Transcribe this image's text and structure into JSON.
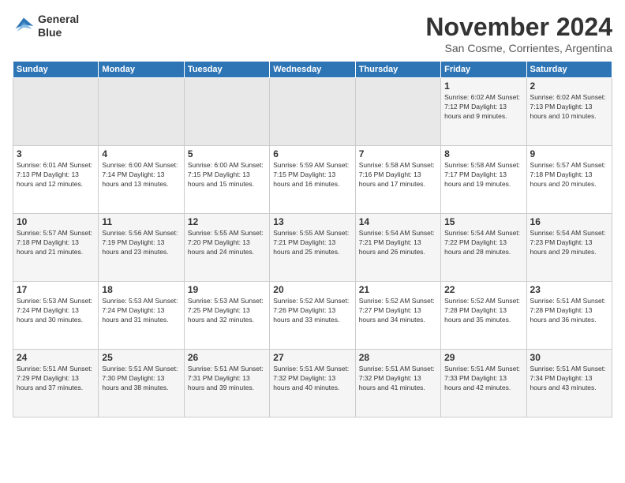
{
  "header": {
    "logo_line1": "General",
    "logo_line2": "Blue",
    "month": "November 2024",
    "location": "San Cosme, Corrientes, Argentina"
  },
  "weekdays": [
    "Sunday",
    "Monday",
    "Tuesday",
    "Wednesday",
    "Thursday",
    "Friday",
    "Saturday"
  ],
  "weeks": [
    [
      {
        "day": "",
        "info": ""
      },
      {
        "day": "",
        "info": ""
      },
      {
        "day": "",
        "info": ""
      },
      {
        "day": "",
        "info": ""
      },
      {
        "day": "",
        "info": ""
      },
      {
        "day": "1",
        "info": "Sunrise: 6:02 AM\nSunset: 7:12 PM\nDaylight: 13 hours\nand 9 minutes."
      },
      {
        "day": "2",
        "info": "Sunrise: 6:02 AM\nSunset: 7:13 PM\nDaylight: 13 hours\nand 10 minutes."
      }
    ],
    [
      {
        "day": "3",
        "info": "Sunrise: 6:01 AM\nSunset: 7:13 PM\nDaylight: 13 hours\nand 12 minutes."
      },
      {
        "day": "4",
        "info": "Sunrise: 6:00 AM\nSunset: 7:14 PM\nDaylight: 13 hours\nand 13 minutes."
      },
      {
        "day": "5",
        "info": "Sunrise: 6:00 AM\nSunset: 7:15 PM\nDaylight: 13 hours\nand 15 minutes."
      },
      {
        "day": "6",
        "info": "Sunrise: 5:59 AM\nSunset: 7:15 PM\nDaylight: 13 hours\nand 16 minutes."
      },
      {
        "day": "7",
        "info": "Sunrise: 5:58 AM\nSunset: 7:16 PM\nDaylight: 13 hours\nand 17 minutes."
      },
      {
        "day": "8",
        "info": "Sunrise: 5:58 AM\nSunset: 7:17 PM\nDaylight: 13 hours\nand 19 minutes."
      },
      {
        "day": "9",
        "info": "Sunrise: 5:57 AM\nSunset: 7:18 PM\nDaylight: 13 hours\nand 20 minutes."
      }
    ],
    [
      {
        "day": "10",
        "info": "Sunrise: 5:57 AM\nSunset: 7:18 PM\nDaylight: 13 hours\nand 21 minutes."
      },
      {
        "day": "11",
        "info": "Sunrise: 5:56 AM\nSunset: 7:19 PM\nDaylight: 13 hours\nand 23 minutes."
      },
      {
        "day": "12",
        "info": "Sunrise: 5:55 AM\nSunset: 7:20 PM\nDaylight: 13 hours\nand 24 minutes."
      },
      {
        "day": "13",
        "info": "Sunrise: 5:55 AM\nSunset: 7:21 PM\nDaylight: 13 hours\nand 25 minutes."
      },
      {
        "day": "14",
        "info": "Sunrise: 5:54 AM\nSunset: 7:21 PM\nDaylight: 13 hours\nand 26 minutes."
      },
      {
        "day": "15",
        "info": "Sunrise: 5:54 AM\nSunset: 7:22 PM\nDaylight: 13 hours\nand 28 minutes."
      },
      {
        "day": "16",
        "info": "Sunrise: 5:54 AM\nSunset: 7:23 PM\nDaylight: 13 hours\nand 29 minutes."
      }
    ],
    [
      {
        "day": "17",
        "info": "Sunrise: 5:53 AM\nSunset: 7:24 PM\nDaylight: 13 hours\nand 30 minutes."
      },
      {
        "day": "18",
        "info": "Sunrise: 5:53 AM\nSunset: 7:24 PM\nDaylight: 13 hours\nand 31 minutes."
      },
      {
        "day": "19",
        "info": "Sunrise: 5:53 AM\nSunset: 7:25 PM\nDaylight: 13 hours\nand 32 minutes."
      },
      {
        "day": "20",
        "info": "Sunrise: 5:52 AM\nSunset: 7:26 PM\nDaylight: 13 hours\nand 33 minutes."
      },
      {
        "day": "21",
        "info": "Sunrise: 5:52 AM\nSunset: 7:27 PM\nDaylight: 13 hours\nand 34 minutes."
      },
      {
        "day": "22",
        "info": "Sunrise: 5:52 AM\nSunset: 7:28 PM\nDaylight: 13 hours\nand 35 minutes."
      },
      {
        "day": "23",
        "info": "Sunrise: 5:51 AM\nSunset: 7:28 PM\nDaylight: 13 hours\nand 36 minutes."
      }
    ],
    [
      {
        "day": "24",
        "info": "Sunrise: 5:51 AM\nSunset: 7:29 PM\nDaylight: 13 hours\nand 37 minutes."
      },
      {
        "day": "25",
        "info": "Sunrise: 5:51 AM\nSunset: 7:30 PM\nDaylight: 13 hours\nand 38 minutes."
      },
      {
        "day": "26",
        "info": "Sunrise: 5:51 AM\nSunset: 7:31 PM\nDaylight: 13 hours\nand 39 minutes."
      },
      {
        "day": "27",
        "info": "Sunrise: 5:51 AM\nSunset: 7:32 PM\nDaylight: 13 hours\nand 40 minutes."
      },
      {
        "day": "28",
        "info": "Sunrise: 5:51 AM\nSunset: 7:32 PM\nDaylight: 13 hours\nand 41 minutes."
      },
      {
        "day": "29",
        "info": "Sunrise: 5:51 AM\nSunset: 7:33 PM\nDaylight: 13 hours\nand 42 minutes."
      },
      {
        "day": "30",
        "info": "Sunrise: 5:51 AM\nSunset: 7:34 PM\nDaylight: 13 hours\nand 43 minutes."
      }
    ]
  ]
}
